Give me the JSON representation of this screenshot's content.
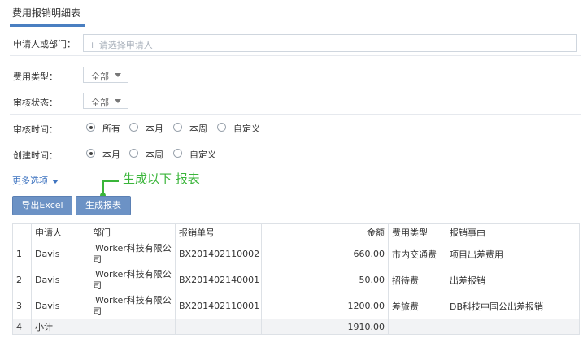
{
  "header": {
    "title": "费用报销明细表"
  },
  "form": {
    "applicant": {
      "label": "申请人或部门：",
      "placeholder": "+ 请选择申请人"
    },
    "expense_type": {
      "label": "费用类型：",
      "value": "全部"
    },
    "review_status": {
      "label": "审核状态：",
      "value": "全部"
    },
    "review_time": {
      "label": "审核时间：",
      "options": [
        "所有",
        "本月",
        "本周",
        "自定义"
      ],
      "selected": "所有"
    },
    "created_time": {
      "label": "创建时间：",
      "options": [
        "本月",
        "本周",
        "自定义"
      ],
      "selected": "本月"
    },
    "more_options": "更多选项"
  },
  "buttons": {
    "export": "导出Excel",
    "generate": "生成报表"
  },
  "annotation": "生成以下 报表",
  "table": {
    "headers": [
      "",
      "申请人",
      "部门",
      "报销单号",
      "金额",
      "费用类型",
      "报销事由"
    ],
    "rows": [
      [
        "1",
        "Davis",
        "iWorker科技有限公司",
        "BX201402110002",
        "660.00",
        "市内交通费",
        "项目出差费用"
      ],
      [
        "2",
        "Davis",
        "iWorker科技有限公司",
        "BX201402140001",
        "50.00",
        "招待费",
        "出差报销"
      ],
      [
        "3",
        "Davis",
        "iWorker科技有限公司",
        "BX201402110001",
        "1200.00",
        "差旅费",
        "DB科技中国公出差报销"
      ]
    ],
    "subtotal": [
      "4",
      "小计",
      "",
      "",
      "1910.00",
      "",
      ""
    ]
  },
  "colors": {
    "accent": "#4a7fc1",
    "button": "#6c92c5",
    "annotation": "#3ab53a"
  }
}
